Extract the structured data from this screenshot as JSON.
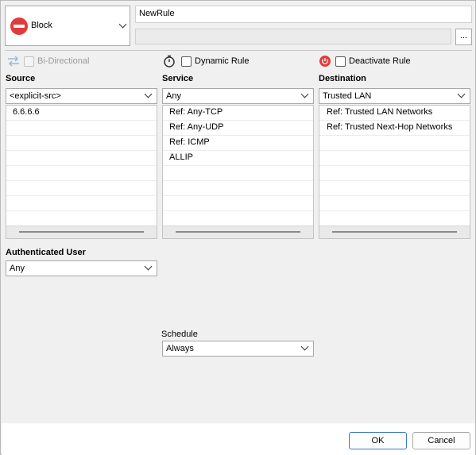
{
  "action": {
    "label": "Block",
    "icon": "block-icon",
    "color": "#e23b3b"
  },
  "rule": {
    "name": "NewRule",
    "comment": "",
    "more_label": "..."
  },
  "options": {
    "bidirectional": {
      "label": "Bi-Directional",
      "checked": false,
      "enabled": false
    },
    "dynamic_rule": {
      "label": "Dynamic Rule",
      "checked": false
    },
    "deactivate_rule": {
      "label": "Deactivate Rule",
      "checked": false,
      "icon_color": "#e23b3b"
    }
  },
  "source": {
    "heading": "Source",
    "selected": "<explicit-src>",
    "items": [
      "6.6.6.6",
      "",
      "",
      "",
      "",
      "",
      "",
      ""
    ]
  },
  "service": {
    "heading": "Service",
    "selected": "Any",
    "items": [
      "Ref: Any-TCP",
      "Ref: Any-UDP",
      "Ref: ICMP",
      "ALLIP",
      "",
      "",
      "",
      ""
    ]
  },
  "destination": {
    "heading": "Destination",
    "selected": "Trusted LAN",
    "items": [
      "Ref: Trusted LAN Networks",
      "Ref: Trusted Next-Hop Networks",
      "",
      "",
      "",
      "",
      ""
    ]
  },
  "authenticated_user": {
    "heading": "Authenticated User",
    "selected": "Any"
  },
  "schedule": {
    "label": "Schedule",
    "selected": "Always"
  },
  "buttons": {
    "ok": "OK",
    "cancel": "Cancel"
  }
}
